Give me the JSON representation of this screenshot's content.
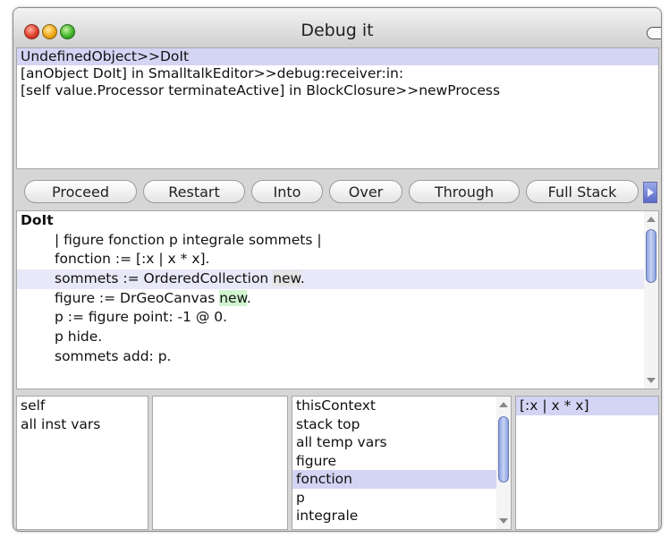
{
  "window": {
    "title": "Debug it"
  },
  "stack": {
    "items": [
      {
        "label": "UndefinedObject>>DoIt",
        "selected": true
      },
      {
        "label": "[anObject DoIt] in SmalltalkEditor>>debug:receiver:in:",
        "selected": false
      },
      {
        "label": "[self value.Processor terminateActive] in BlockClosure>>newProcess",
        "selected": false
      }
    ]
  },
  "toolbar": {
    "buttons": [
      "Proceed",
      "Restart",
      "Into",
      "Over",
      "Through",
      "Full Stack"
    ],
    "more_icon": "right-arrow-icon"
  },
  "code": {
    "method": "DoIt",
    "lines": [
      "| figure fonction p integrale sommets |",
      "fonction := [:x | x * x].",
      "sommets := OrderedCollection new.",
      "figure := DrGeoCanvas new.",
      "p := figure point: -1 @ 0.",
      "p hide.",
      "sommets add: p."
    ],
    "line2_prefix": "sommets := OrderedCollection ",
    "line2_highlight": "new",
    "line2_suffix": ".",
    "line3_prefix": "figure := DrGeoCanvas ",
    "line3_highlight": "new",
    "line3_suffix": ".",
    "highlight_colors": {
      "selected_line": "#e8e8f8",
      "grey": "#e4e4e4",
      "green": "#d0f5d0"
    }
  },
  "receiver_inspector": {
    "items": [
      "self",
      "all inst vars"
    ]
  },
  "receiver_value": {
    "text": ""
  },
  "context_inspector": {
    "items": [
      "thisContext",
      "stack top",
      "all temp vars",
      "figure",
      "fonction",
      "p",
      "integrale"
    ],
    "selected_index": 4
  },
  "context_value": {
    "text": "[:x | x * x]"
  },
  "colors": {
    "selection": "#d4d4f4",
    "window_bg": "#d6d6d6",
    "scroll_thumb": "#8aa0e0"
  }
}
